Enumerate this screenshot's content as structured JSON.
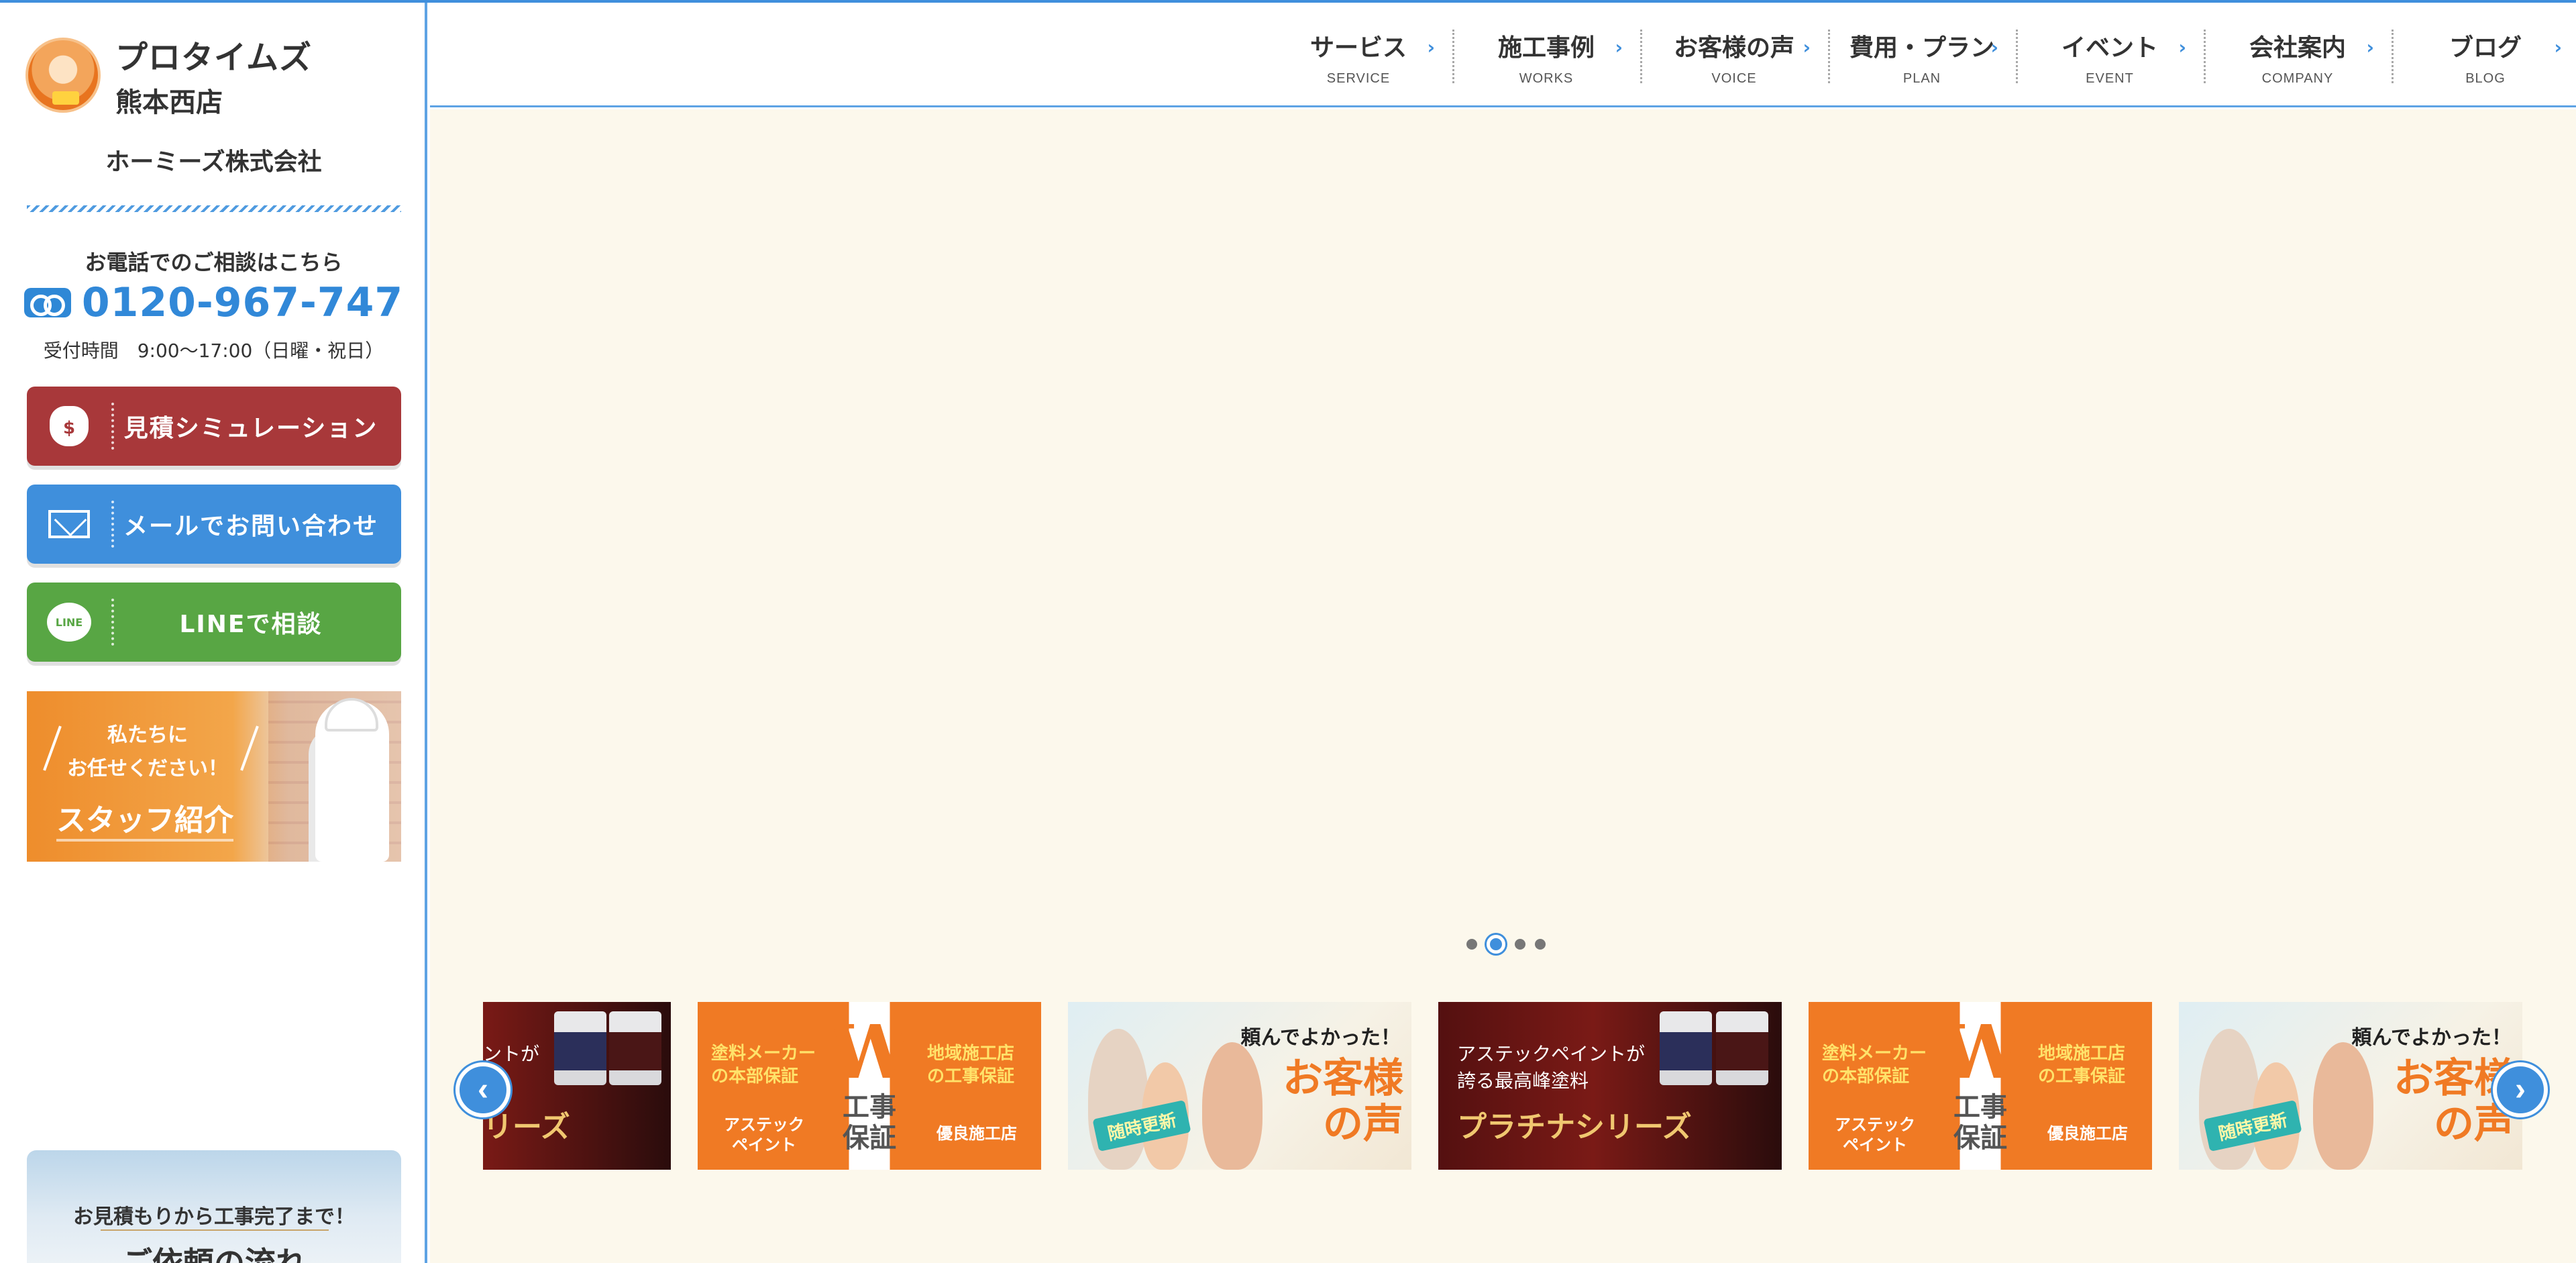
{
  "sidebar": {
    "logo_name": "プロタイムズ",
    "logo_branch": "熊本西店",
    "company": "ホーミーズ株式会社",
    "tel_caption": "お電話でのご相談はこちら",
    "tel_number": "0120-967-747",
    "tel_hours": "受付時間　9:00〜17:00（日曜・祝日）",
    "buttons": {
      "simulation": "見積シミュレーション",
      "mail": "メールでお問い合わせ",
      "line": "LINEで相談"
    },
    "wallet_symbol": "$",
    "line_icon_text": "LINE",
    "staff_banner": {
      "line1": "私たちに",
      "line2": "お任せください！",
      "title": "スタッフ紹介"
    },
    "flow_banner": {
      "line1": "お見積もりから工事完了まで！",
      "title": "ご依頼の流れ"
    }
  },
  "nav": [
    {
      "jp": "サービス",
      "en": "SERVICE"
    },
    {
      "jp": "施工事例",
      "en": "WORKS"
    },
    {
      "jp": "お客様の声",
      "en": "VOICE"
    },
    {
      "jp": "費用・プラン",
      "en": "PLAN"
    },
    {
      "jp": "イベント",
      "en": "EVENT"
    },
    {
      "jp": "会社案内",
      "en": "COMPANY"
    },
    {
      "jp": "ブログ",
      "en": "BLOG"
    }
  ],
  "slider": {
    "dot_count": 4,
    "active_dot": 2
  },
  "banners": {
    "paint": {
      "line1_partial": "ントが",
      "line1": "アステックペイントが",
      "line2": "誇る最高峰塗料",
      "title": "プラチナシリーズ",
      "title_partial": "リーズ"
    },
    "warranty": {
      "left1": "塗料メーカー",
      "left2": "の本部保証",
      "left3": "アステック ペイント",
      "center_letter": "W",
      "center_text": "工事 保証",
      "right1": "地域施工店",
      "right2": "の工事保証",
      "right3": "優良施工店"
    },
    "voice": {
      "top": "頼んでよかった！",
      "big": "お客様 の声",
      "badge": "随時更新"
    }
  },
  "colors": {
    "accent_blue": "#3f8fdc",
    "estimate_red": "#a8383a",
    "line_green": "#58a644",
    "main_bg": "#fcf8ec",
    "banner_orange": "#f07a24"
  },
  "icons": {
    "prev": "chevron-left-icon",
    "next": "chevron-right-icon",
    "nav": "chevron-right-icon"
  }
}
